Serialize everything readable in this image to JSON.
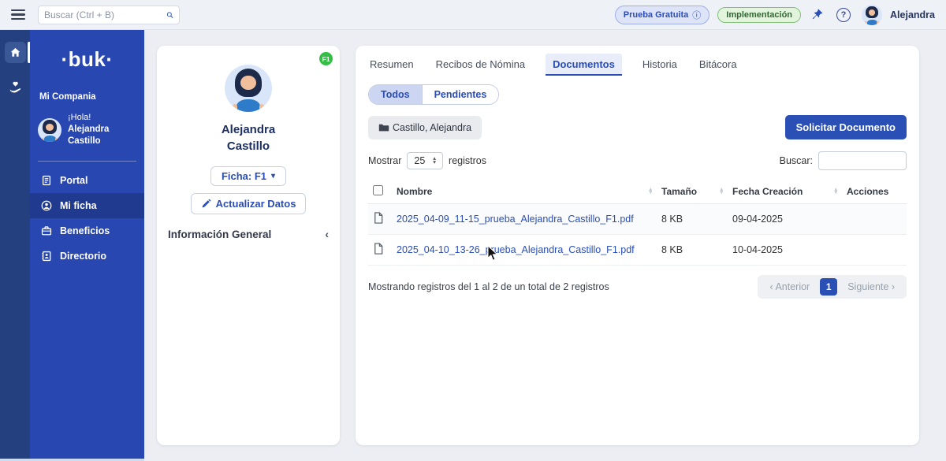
{
  "icons": {
    "info": "ⓘ",
    "help": "?",
    "caret_down": "▾",
    "chevron_left": "‹",
    "chevron_right": "›",
    "sort_up": "▴",
    "sort_down": "▾"
  },
  "topbar": {
    "search_placeholder": "Buscar (Ctrl + B)",
    "trial_badge": "Prueba Gratuita",
    "implementation_badge": "Implementación",
    "user_name": "Alejandra"
  },
  "sidebar": {
    "logo": "·buk·",
    "company_label": "Mi Compania",
    "greeting": "¡Hola!",
    "user_name": "Alejandra Castillo",
    "items": [
      {
        "label": "Portal"
      },
      {
        "label": "Mi ficha"
      },
      {
        "label": "Beneficios"
      },
      {
        "label": "Directorio"
      }
    ]
  },
  "profile_card": {
    "badge": "F1",
    "name_line1": "Alejandra",
    "name_line2": "Castillo",
    "ficha_button": "Ficha: F1",
    "update_button": "Actualizar Datos",
    "section_title": "Información General"
  },
  "main": {
    "tabs": [
      {
        "label": "Resumen"
      },
      {
        "label": "Recibos de Nómina"
      },
      {
        "label": "Documentos"
      },
      {
        "label": "Historia"
      },
      {
        "label": "Bitácora"
      }
    ],
    "filter_toggle": [
      {
        "label": "Todos"
      },
      {
        "label": "Pendientes"
      }
    ],
    "folder_chip": "Castillo, Alejandra",
    "request_button": "Solicitar Documento",
    "show_label": "Mostrar",
    "show_value": "25",
    "records_label": "registros",
    "search_label": "Buscar:",
    "table": {
      "headers": [
        "Nombre",
        "Tamaño",
        "Fecha Creación",
        "Acciones"
      ],
      "rows": [
        {
          "name": "2025_04-09_11-15_prueba_Alejandra_Castillo_F1.pdf",
          "size": "8 KB",
          "date": "09-04-2025"
        },
        {
          "name": "2025_04-10_13-26_prueba_Alejandra_Castillo_F1.pdf",
          "size": "8 KB",
          "date": "10-04-2025"
        }
      ]
    },
    "footer_text": "Mostrando registros del 1 al 2 de un total de 2 registros",
    "pagination": {
      "prev": "Anterior",
      "page": "1",
      "next": "Siguiente"
    }
  },
  "colors": {
    "accent_blue": "#2a4db6",
    "sidebar_blue": "#2847b0",
    "rail_navy": "#24407f",
    "success_green": "#35bd47"
  }
}
